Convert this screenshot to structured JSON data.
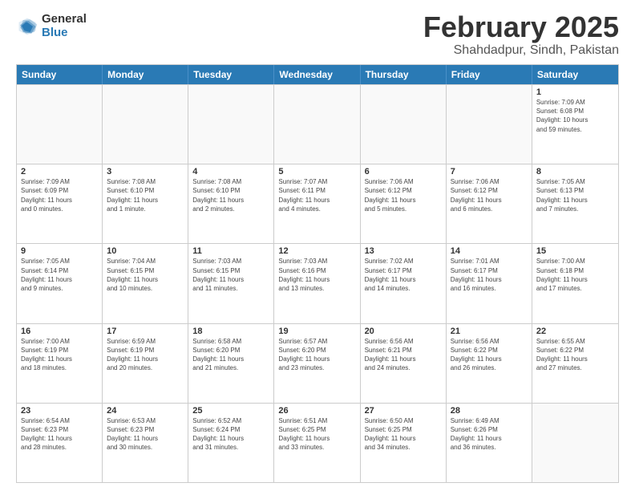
{
  "logo": {
    "general": "General",
    "blue": "Blue"
  },
  "title": "February 2025",
  "subtitle": "Shahdadpur, Sindh, Pakistan",
  "headers": [
    "Sunday",
    "Monday",
    "Tuesday",
    "Wednesday",
    "Thursday",
    "Friday",
    "Saturday"
  ],
  "rows": [
    [
      {
        "day": "",
        "info": ""
      },
      {
        "day": "",
        "info": ""
      },
      {
        "day": "",
        "info": ""
      },
      {
        "day": "",
        "info": ""
      },
      {
        "day": "",
        "info": ""
      },
      {
        "day": "",
        "info": ""
      },
      {
        "day": "1",
        "info": "Sunrise: 7:09 AM\nSunset: 6:08 PM\nDaylight: 10 hours\nand 59 minutes."
      }
    ],
    [
      {
        "day": "2",
        "info": "Sunrise: 7:09 AM\nSunset: 6:09 PM\nDaylight: 11 hours\nand 0 minutes."
      },
      {
        "day": "3",
        "info": "Sunrise: 7:08 AM\nSunset: 6:10 PM\nDaylight: 11 hours\nand 1 minute."
      },
      {
        "day": "4",
        "info": "Sunrise: 7:08 AM\nSunset: 6:10 PM\nDaylight: 11 hours\nand 2 minutes."
      },
      {
        "day": "5",
        "info": "Sunrise: 7:07 AM\nSunset: 6:11 PM\nDaylight: 11 hours\nand 4 minutes."
      },
      {
        "day": "6",
        "info": "Sunrise: 7:06 AM\nSunset: 6:12 PM\nDaylight: 11 hours\nand 5 minutes."
      },
      {
        "day": "7",
        "info": "Sunrise: 7:06 AM\nSunset: 6:12 PM\nDaylight: 11 hours\nand 6 minutes."
      },
      {
        "day": "8",
        "info": "Sunrise: 7:05 AM\nSunset: 6:13 PM\nDaylight: 11 hours\nand 7 minutes."
      }
    ],
    [
      {
        "day": "9",
        "info": "Sunrise: 7:05 AM\nSunset: 6:14 PM\nDaylight: 11 hours\nand 9 minutes."
      },
      {
        "day": "10",
        "info": "Sunrise: 7:04 AM\nSunset: 6:15 PM\nDaylight: 11 hours\nand 10 minutes."
      },
      {
        "day": "11",
        "info": "Sunrise: 7:03 AM\nSunset: 6:15 PM\nDaylight: 11 hours\nand 11 minutes."
      },
      {
        "day": "12",
        "info": "Sunrise: 7:03 AM\nSunset: 6:16 PM\nDaylight: 11 hours\nand 13 minutes."
      },
      {
        "day": "13",
        "info": "Sunrise: 7:02 AM\nSunset: 6:17 PM\nDaylight: 11 hours\nand 14 minutes."
      },
      {
        "day": "14",
        "info": "Sunrise: 7:01 AM\nSunset: 6:17 PM\nDaylight: 11 hours\nand 16 minutes."
      },
      {
        "day": "15",
        "info": "Sunrise: 7:00 AM\nSunset: 6:18 PM\nDaylight: 11 hours\nand 17 minutes."
      }
    ],
    [
      {
        "day": "16",
        "info": "Sunrise: 7:00 AM\nSunset: 6:19 PM\nDaylight: 11 hours\nand 18 minutes."
      },
      {
        "day": "17",
        "info": "Sunrise: 6:59 AM\nSunset: 6:19 PM\nDaylight: 11 hours\nand 20 minutes."
      },
      {
        "day": "18",
        "info": "Sunrise: 6:58 AM\nSunset: 6:20 PM\nDaylight: 11 hours\nand 21 minutes."
      },
      {
        "day": "19",
        "info": "Sunrise: 6:57 AM\nSunset: 6:20 PM\nDaylight: 11 hours\nand 23 minutes."
      },
      {
        "day": "20",
        "info": "Sunrise: 6:56 AM\nSunset: 6:21 PM\nDaylight: 11 hours\nand 24 minutes."
      },
      {
        "day": "21",
        "info": "Sunrise: 6:56 AM\nSunset: 6:22 PM\nDaylight: 11 hours\nand 26 minutes."
      },
      {
        "day": "22",
        "info": "Sunrise: 6:55 AM\nSunset: 6:22 PM\nDaylight: 11 hours\nand 27 minutes."
      }
    ],
    [
      {
        "day": "23",
        "info": "Sunrise: 6:54 AM\nSunset: 6:23 PM\nDaylight: 11 hours\nand 28 minutes."
      },
      {
        "day": "24",
        "info": "Sunrise: 6:53 AM\nSunset: 6:23 PM\nDaylight: 11 hours\nand 30 minutes."
      },
      {
        "day": "25",
        "info": "Sunrise: 6:52 AM\nSunset: 6:24 PM\nDaylight: 11 hours\nand 31 minutes."
      },
      {
        "day": "26",
        "info": "Sunrise: 6:51 AM\nSunset: 6:25 PM\nDaylight: 11 hours\nand 33 minutes."
      },
      {
        "day": "27",
        "info": "Sunrise: 6:50 AM\nSunset: 6:25 PM\nDaylight: 11 hours\nand 34 minutes."
      },
      {
        "day": "28",
        "info": "Sunrise: 6:49 AM\nSunset: 6:26 PM\nDaylight: 11 hours\nand 36 minutes."
      },
      {
        "day": "",
        "info": ""
      }
    ]
  ]
}
